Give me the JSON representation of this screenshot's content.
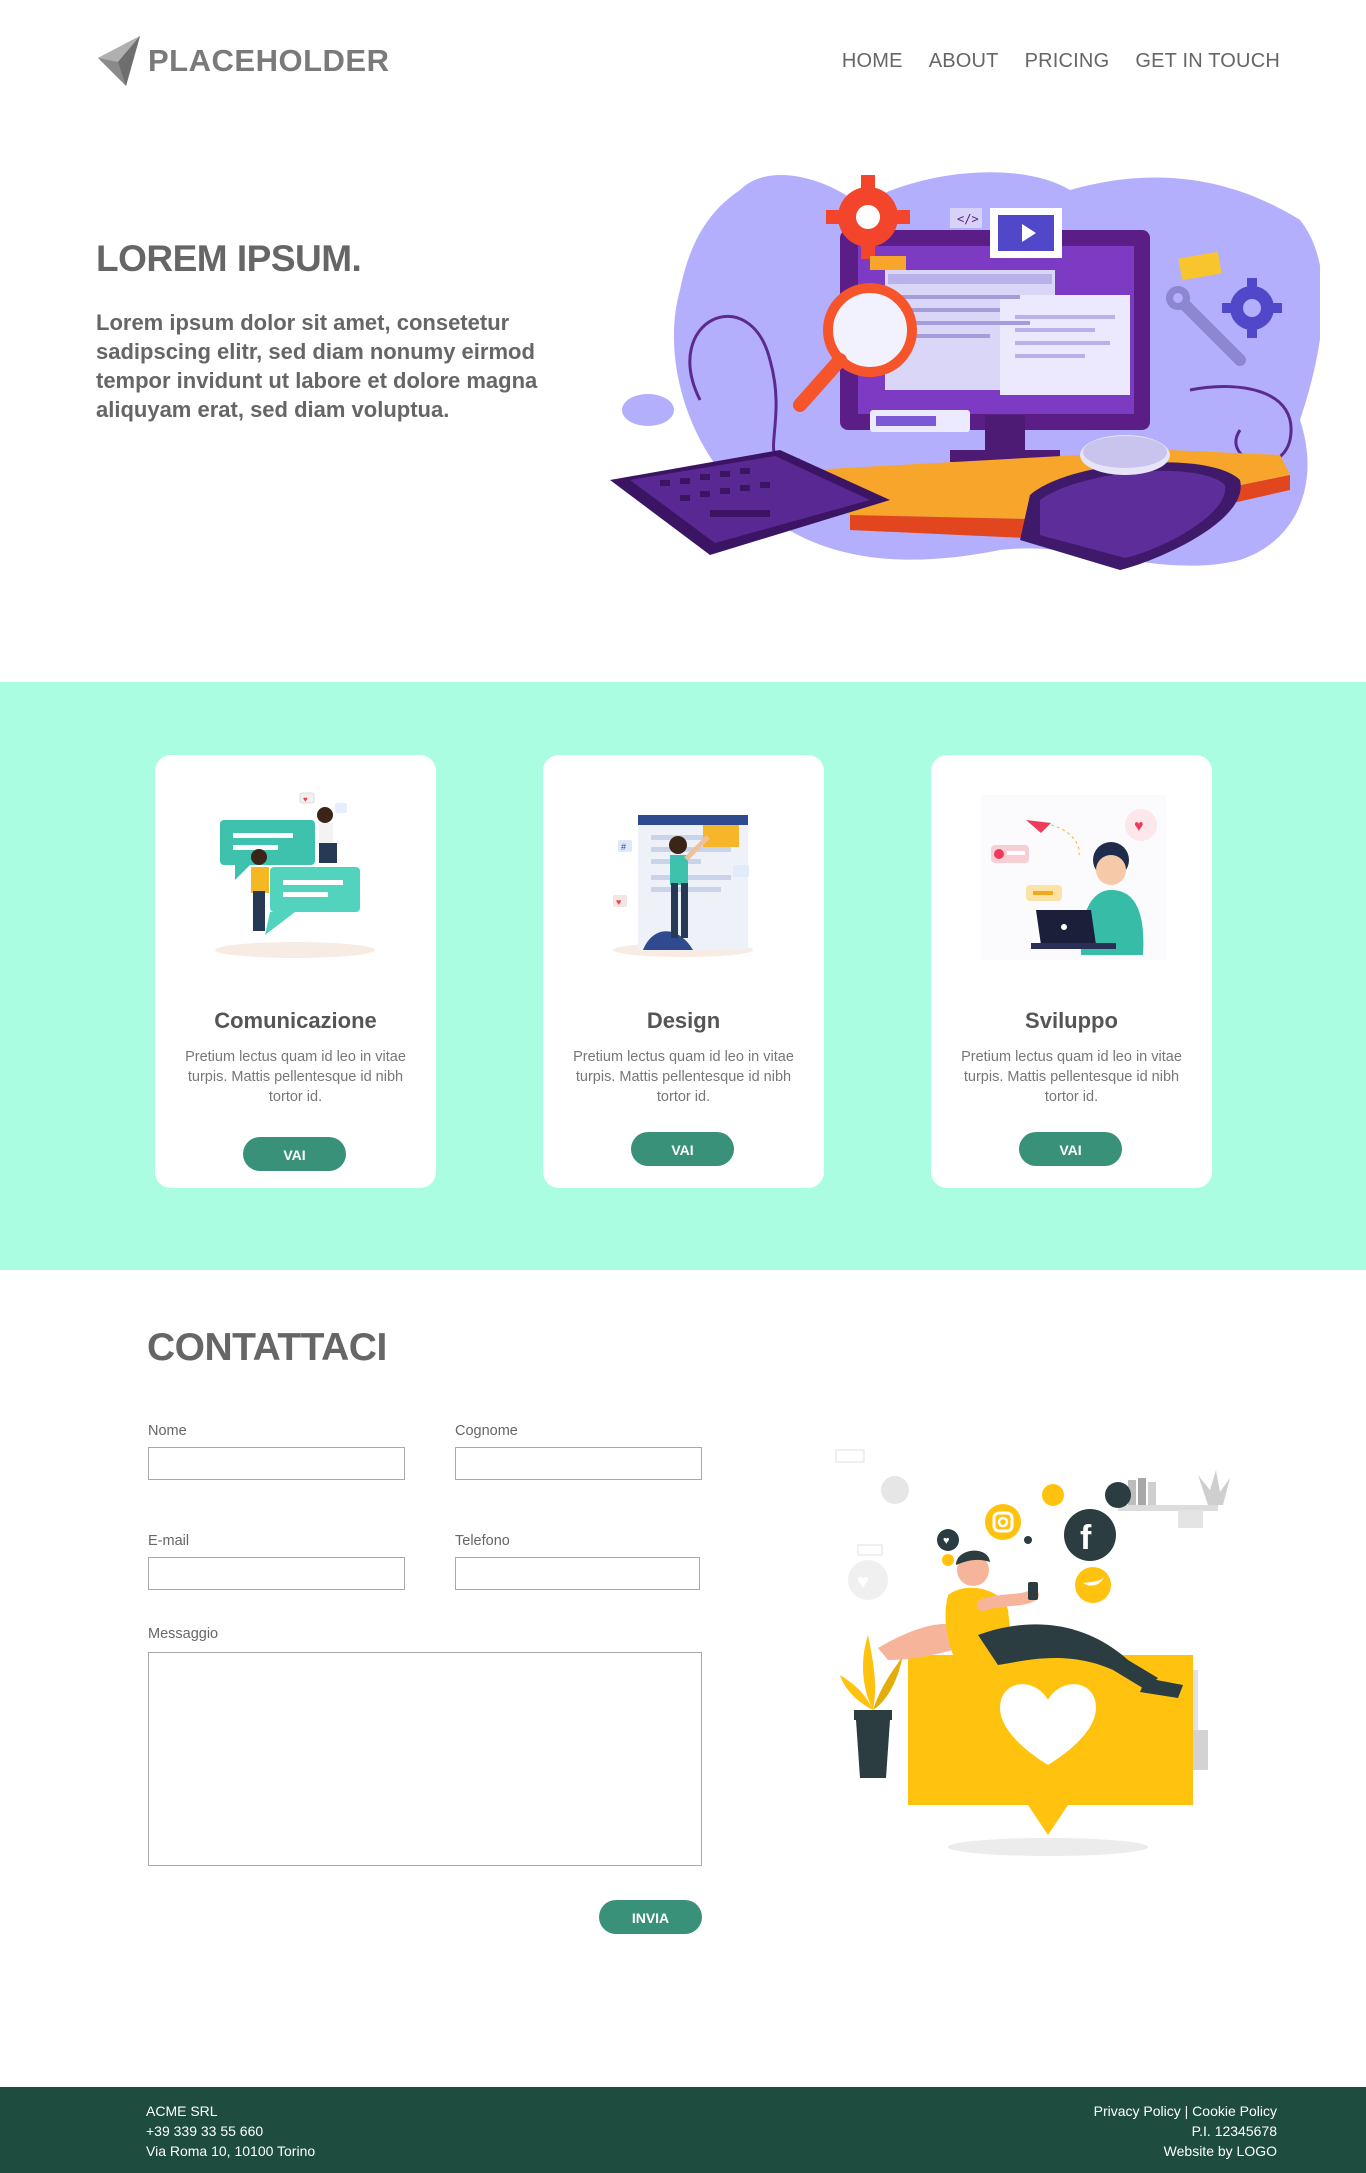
{
  "header": {
    "logo_text": "PLACEHOLDER",
    "nav": [
      "HOME",
      "ABOUT",
      "PRICING",
      "GET IN TOUCH"
    ]
  },
  "hero": {
    "title": "LOREM IPSUM.",
    "text": "Lorem ipsum dolor sit amet, consetetur sadipscing elitr, sed diam nonumy eirmod tempor invidunt ut labore et dolore magna aliquyam erat, sed diam voluptua."
  },
  "services": {
    "cards": [
      {
        "title": "Comunicazione",
        "text": "Pretium lectus quam id leo in vitae turpis. Mattis pellentesque id nibh tortor id.",
        "button": "VAI"
      },
      {
        "title": "Design",
        "text": "Pretium lectus quam id leo in vitae turpis. Mattis pellentesque id nibh tortor id.",
        "button": "VAI"
      },
      {
        "title": "Sviluppo",
        "text": "Pretium lectus quam id leo in vitae turpis. Mattis pellentesque id nibh tortor id.",
        "button": "VAI"
      }
    ]
  },
  "contact": {
    "title": "CONTATTACI",
    "labels": {
      "nome": "Nome",
      "cognome": "Cognome",
      "email": "E-mail",
      "telefono": "Telefono",
      "messaggio": "Messaggio"
    },
    "submit": "INVIA"
  },
  "footer": {
    "company": "ACME SRL",
    "phone": "+39 339 33 55 660",
    "address": "Via Roma 10, 10100 Torino",
    "privacy": "Privacy Policy",
    "separator": " | ",
    "cookie": "Cookie Policy",
    "vat": "P.I. 12345678",
    "credit": "Website by LOGO"
  },
  "colors": {
    "band": "#aafde1",
    "button": "#39917a",
    "footer": "#1e4d3f",
    "heading": "#666666"
  }
}
